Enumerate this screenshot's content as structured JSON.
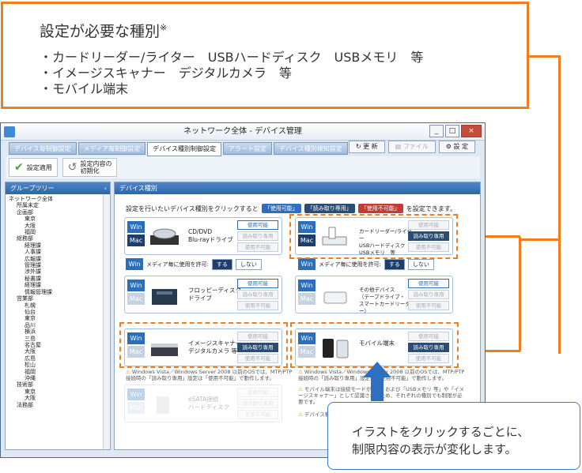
{
  "callout": {
    "title": "設定が必要な種別",
    "title_mark": "※",
    "items": [
      "カードリーダー/ライター　USBハードディスク　USBメモリ　等",
      "イメージスキャナー　デジタルカメラ　等",
      "モバイル端末"
    ]
  },
  "window": {
    "title": "ネットワーク全体 - デバイス管理",
    "buttons": {
      "minimize": "_",
      "maximize": "□",
      "close": "×"
    }
  },
  "tabs": [
    "デバイス毎制御設定",
    "メディア毎制御設定",
    "デバイス種別制御設定",
    "アラート設定",
    "デバイス種別検知設定"
  ],
  "active_tab": "デバイス種別制御設定",
  "toolbar": {
    "refresh": "更 新",
    "file": "ファイル",
    "settings": "設 定",
    "apply": "設定適用",
    "init": "設定内容の\n初期化"
  },
  "left_panel": {
    "title": "グループツリー",
    "collapse": "‹",
    "tree": [
      "ネットワーク全体",
      "所属未定",
      "企画部",
      "東京",
      "大阪",
      "福岡",
      "総務部",
      "経理課",
      "人事課",
      "広報課",
      "管理課",
      "渉外課",
      "秘書課",
      "経理課",
      "情報管理課",
      "営業部",
      "札幌",
      "仙台",
      "東京",
      "品川",
      "横浜",
      "三島",
      "名古屋",
      "大阪",
      "広島",
      "松山",
      "福岡",
      "沖縄",
      "技術部",
      "東京",
      "大阪",
      "法務部"
    ]
  },
  "right_panel": {
    "title": "デバイス種別",
    "desc_pre": "設定を行いたいデバイス種別をクリックすると",
    "pill_usable": "「使用可能」",
    "pill_readonly": "「読み取り専用」",
    "pill_unusable": "「使用不可能」",
    "desc_post": "を設定できます。",
    "media_label": "メディア毎に使用を許可:",
    "media_on": "する",
    "media_off": "しない",
    "win": "Win",
    "mac": "Mac",
    "opt_usable": "使用可能",
    "opt_readonly": "読み取り専用",
    "opt_unusable": "使用不可能",
    "cards": [
      {
        "name": "CD/DVD\nBlu-rayドライブ"
      },
      {
        "name": "カードリーダー/ライター\nUSBハードディスク\nUSBメモリ　等"
      },
      {
        "name": "フロッピーディスク\nドライブ"
      },
      {
        "name": "その他デバイス\n（テープドライブ・\nスマートカードリーダー）"
      },
      {
        "name": "イメージスキャナー\nデジタルカメラ 等"
      },
      {
        "name": "モバイル端末"
      },
      {
        "name": "eSATA接続\nハードディスク"
      }
    ],
    "warn_left": "Windows Vista／Windows Server 2008 以前のOSでは、MTP/PTP接続時の「読み取り専用」設定は「使用不可能」で動作します。",
    "warn_right": "Windows Vista／Windows Server 2008 以前のOSでは、MTP/PTP接続時の「読み取り専用」設定は「使用不可能」で動作します。",
    "warn2": "モバイル端末は接続モードが MTP および「USBメモリ 等」や「イメージスキャナー」として認識されるため、それぞれの種別でも制限が必要です。",
    "warn3": "デバイス種別"
  },
  "bubble": {
    "text": "イラストをクリックするごとに、\n制限内容の表示が変化します。"
  },
  "colors": {
    "accent": "#f07d1e",
    "blue": "#2c6eb9",
    "navy": "#1e3f6d",
    "red": "#c53a32"
  }
}
